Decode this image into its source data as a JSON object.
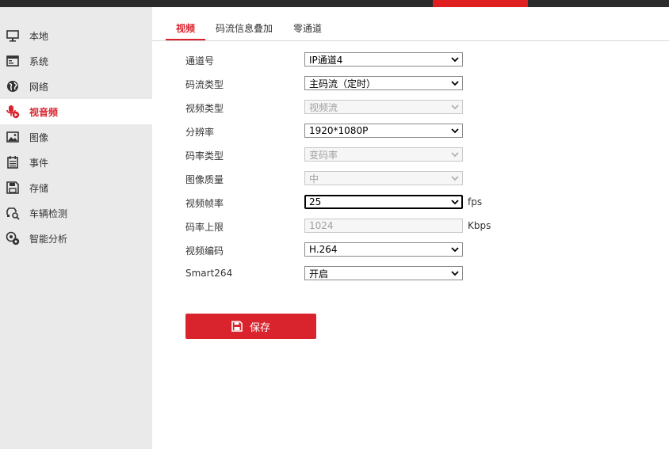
{
  "sidebar": {
    "items": [
      {
        "label": "本地",
        "icon": "monitor-icon"
      },
      {
        "label": "系统",
        "icon": "window-icon"
      },
      {
        "label": "网络",
        "icon": "globe-icon"
      },
      {
        "label": "视音频",
        "icon": "microphone-icon",
        "active": true
      },
      {
        "label": "图像",
        "icon": "image-icon"
      },
      {
        "label": "事件",
        "icon": "calendar-icon"
      },
      {
        "label": "存储",
        "icon": "save-icon"
      },
      {
        "label": "车辆检测",
        "icon": "vehicle-search-icon"
      },
      {
        "label": "智能分析",
        "icon": "smart-analysis-icon"
      }
    ]
  },
  "tabs": [
    {
      "label": "视频",
      "active": true
    },
    {
      "label": "码流信息叠加"
    },
    {
      "label": "零通道"
    }
  ],
  "form": {
    "channel": {
      "label": "通道号",
      "value": "IP通道4"
    },
    "stream_type": {
      "label": "码流类型",
      "value": "主码流（定时）"
    },
    "video_type": {
      "label": "视频类型",
      "value": "视频流"
    },
    "resolution": {
      "label": "分辨率",
      "value": "1920*1080P"
    },
    "bitrate_type": {
      "label": "码率类型",
      "value": "变码率"
    },
    "image_quality": {
      "label": "图像质量",
      "value": "中"
    },
    "frame_rate": {
      "label": "视频帧率",
      "value": "25",
      "unit": "fps"
    },
    "max_bitrate": {
      "label": "码率上限",
      "value": "1024",
      "unit": "Kbps"
    },
    "encoding": {
      "label": "视频编码",
      "value": "H.264"
    },
    "smart264": {
      "label": "Smart264",
      "value": "开启"
    }
  },
  "save_label": "保存",
  "colors": {
    "accent": "#d9232d",
    "topbar": "#2b2b2b",
    "sidebar_bg": "#eaeaea"
  }
}
